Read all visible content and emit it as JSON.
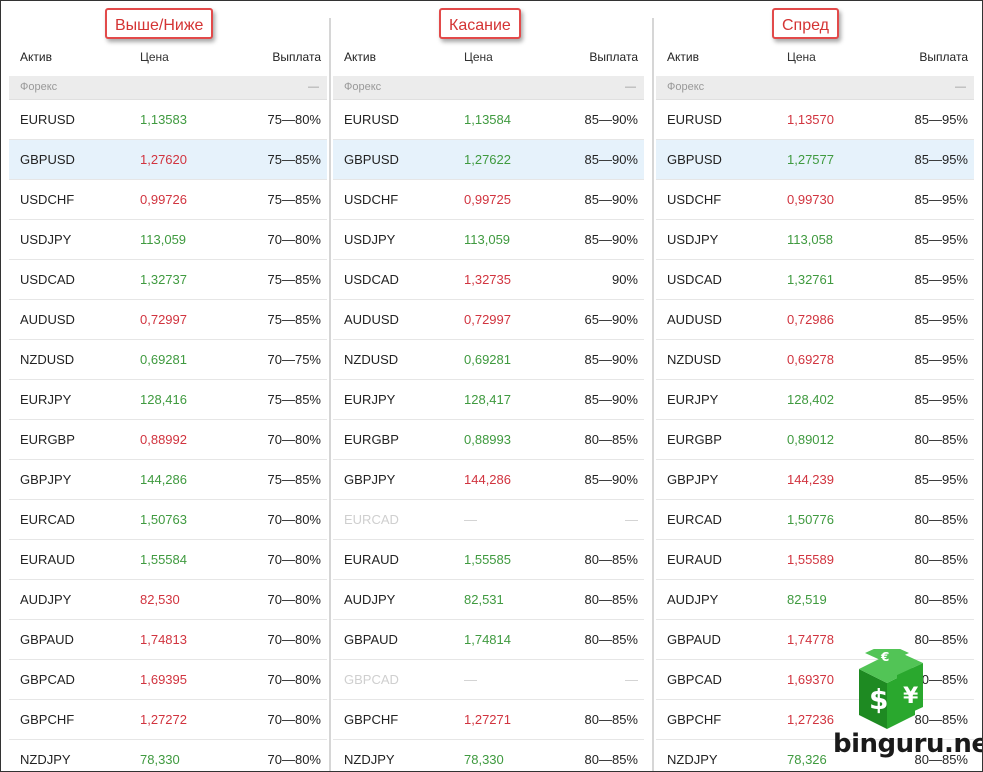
{
  "columns": {
    "asset": "Актив",
    "price": "Цена",
    "payout": "Выплата"
  },
  "group_label": "Форекс",
  "group_dash": "—",
  "colors": {
    "up": "#3f9a3f",
    "down": "#d1343f",
    "highlight": "#e6f2fb",
    "tag_border": "#e24a4a"
  },
  "panels": [
    {
      "title": "Выше/Ниже",
      "rows": [
        {
          "asset": "EURUSD",
          "price": "1,13583",
          "payout": "75—80%",
          "trend": "up"
        },
        {
          "asset": "GBPUSD",
          "price": "1,27620",
          "payout": "75—85%",
          "trend": "down",
          "highlighted": true
        },
        {
          "asset": "USDCHF",
          "price": "0,99726",
          "payout": "75—85%",
          "trend": "down"
        },
        {
          "asset": "USDJPY",
          "price": "113,059",
          "payout": "70—80%",
          "trend": "up"
        },
        {
          "asset": "USDCAD",
          "price": "1,32737",
          "payout": "75—85%",
          "trend": "up"
        },
        {
          "asset": "AUDUSD",
          "price": "0,72997",
          "payout": "75—85%",
          "trend": "down"
        },
        {
          "asset": "NZDUSD",
          "price": "0,69281",
          "payout": "70—75%",
          "trend": "up"
        },
        {
          "asset": "EURJPY",
          "price": "128,416",
          "payout": "75—85%",
          "trend": "up"
        },
        {
          "asset": "EURGBP",
          "price": "0,88992",
          "payout": "70—80%",
          "trend": "down"
        },
        {
          "asset": "GBPJPY",
          "price": "144,286",
          "payout": "75—85%",
          "trend": "up"
        },
        {
          "asset": "EURCAD",
          "price": "1,50763",
          "payout": "70—80%",
          "trend": "up"
        },
        {
          "asset": "EURAUD",
          "price": "1,55584",
          "payout": "70—80%",
          "trend": "up"
        },
        {
          "asset": "AUDJPY",
          "price": "82,530",
          "payout": "70—80%",
          "trend": "down"
        },
        {
          "asset": "GBPAUD",
          "price": "1,74813",
          "payout": "70—80%",
          "trend": "down"
        },
        {
          "asset": "GBPCAD",
          "price": "1,69395",
          "payout": "70—80%",
          "trend": "down"
        },
        {
          "asset": "GBPCHF",
          "price": "1,27272",
          "payout": "70—80%",
          "trend": "down"
        },
        {
          "asset": "NZDJPY",
          "price": "78,330",
          "payout": "70—80%",
          "trend": "up"
        }
      ]
    },
    {
      "title": "Касание",
      "rows": [
        {
          "asset": "EURUSD",
          "price": "1,13584",
          "payout": "85—90%",
          "trend": "up"
        },
        {
          "asset": "GBPUSD",
          "price": "1,27622",
          "payout": "85—90%",
          "trend": "up",
          "highlighted": true
        },
        {
          "asset": "USDCHF",
          "price": "0,99725",
          "payout": "85—90%",
          "trend": "down"
        },
        {
          "asset": "USDJPY",
          "price": "113,059",
          "payout": "85—90%",
          "trend": "up"
        },
        {
          "asset": "USDCAD",
          "price": "1,32735",
          "payout": "90%",
          "trend": "down"
        },
        {
          "asset": "AUDUSD",
          "price": "0,72997",
          "payout": "65—90%",
          "trend": "down"
        },
        {
          "asset": "NZDUSD",
          "price": "0,69281",
          "payout": "85—90%",
          "trend": "up"
        },
        {
          "asset": "EURJPY",
          "price": "128,417",
          "payout": "85—90%",
          "trend": "up"
        },
        {
          "asset": "EURGBP",
          "price": "0,88993",
          "payout": "80—85%",
          "trend": "up"
        },
        {
          "asset": "GBPJPY",
          "price": "144,286",
          "payout": "85—90%",
          "trend": "down"
        },
        {
          "asset": "EURCAD",
          "price": "—",
          "payout": "—",
          "trend": "none",
          "disabled": true
        },
        {
          "asset": "EURAUD",
          "price": "1,55585",
          "payout": "80—85%",
          "trend": "up"
        },
        {
          "asset": "AUDJPY",
          "price": "82,531",
          "payout": "80—85%",
          "trend": "up"
        },
        {
          "asset": "GBPAUD",
          "price": "1,74814",
          "payout": "80—85%",
          "trend": "up"
        },
        {
          "asset": "GBPCAD",
          "price": "—",
          "payout": "—",
          "trend": "none",
          "disabled": true
        },
        {
          "asset": "GBPCHF",
          "price": "1,27271",
          "payout": "80—85%",
          "trend": "down"
        },
        {
          "asset": "NZDJPY",
          "price": "78,330",
          "payout": "80—85%",
          "trend": "up"
        }
      ]
    },
    {
      "title": "Спред",
      "rows": [
        {
          "asset": "EURUSD",
          "price": "1,13570",
          "payout": "85—95%",
          "trend": "down"
        },
        {
          "asset": "GBPUSD",
          "price": "1,27577",
          "payout": "85—95%",
          "trend": "up",
          "highlighted": true
        },
        {
          "asset": "USDCHF",
          "price": "0,99730",
          "payout": "85—95%",
          "trend": "down"
        },
        {
          "asset": "USDJPY",
          "price": "113,058",
          "payout": "85—95%",
          "trend": "up"
        },
        {
          "asset": "USDCAD",
          "price": "1,32761",
          "payout": "85—95%",
          "trend": "up"
        },
        {
          "asset": "AUDUSD",
          "price": "0,72986",
          "payout": "85—95%",
          "trend": "down"
        },
        {
          "asset": "NZDUSD",
          "price": "0,69278",
          "payout": "85—95%",
          "trend": "down"
        },
        {
          "asset": "EURJPY",
          "price": "128,402",
          "payout": "85—95%",
          "trend": "up"
        },
        {
          "asset": "EURGBP",
          "price": "0,89012",
          "payout": "80—85%",
          "trend": "up"
        },
        {
          "asset": "GBPJPY",
          "price": "144,239",
          "payout": "85—95%",
          "trend": "down"
        },
        {
          "asset": "EURCAD",
          "price": "1,50776",
          "payout": "80—85%",
          "trend": "up"
        },
        {
          "asset": "EURAUD",
          "price": "1,55589",
          "payout": "80—85%",
          "trend": "down"
        },
        {
          "asset": "AUDJPY",
          "price": "82,519",
          "payout": "80—85%",
          "trend": "up"
        },
        {
          "asset": "GBPAUD",
          "price": "1,74778",
          "payout": "80—85%",
          "trend": "down"
        },
        {
          "asset": "GBPCAD",
          "price": "1,69370",
          "payout": "80—85%",
          "trend": "down"
        },
        {
          "asset": "GBPCHF",
          "price": "1,27236",
          "payout": "80—85%",
          "trend": "down"
        },
        {
          "asset": "NZDJPY",
          "price": "78,326",
          "payout": "80—85%",
          "trend": "up"
        }
      ]
    }
  ],
  "watermark": {
    "text": "binguru.net",
    "icons": [
      "euro-coin-icon",
      "dollar-coin-icon",
      "yen-coin-icon"
    ]
  }
}
